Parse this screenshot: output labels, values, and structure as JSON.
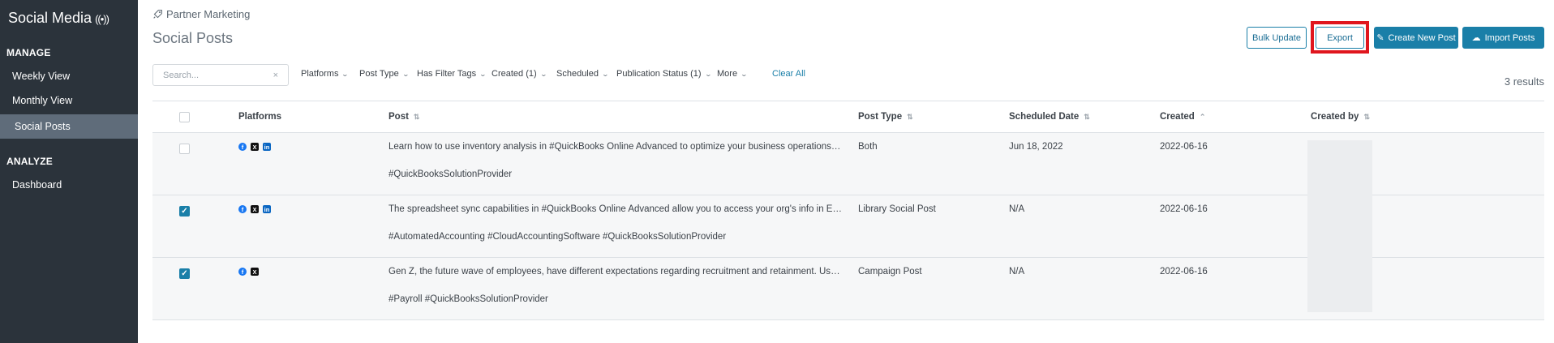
{
  "sidebar": {
    "app_title": "Social Media",
    "manage_label": "MANAGE",
    "analyze_label": "ANALYZE",
    "items": [
      {
        "label": "Weekly View"
      },
      {
        "label": "Monthly View"
      },
      {
        "label": "Social Posts",
        "active": true
      },
      {
        "label": "Dashboard"
      }
    ]
  },
  "header": {
    "breadcrumb": "Partner Marketing",
    "title": "Social Posts"
  },
  "toolbar": {
    "bulk_update": "Bulk Update",
    "export": "Export",
    "create_new_post": "Create New Post",
    "import_posts": "Import Posts"
  },
  "filters": {
    "search_placeholder": "Search...",
    "items": [
      "Platforms",
      "Post Type",
      "Has Filter Tags",
      "Created (1)",
      "Scheduled",
      "Publication Status (1)",
      "More"
    ],
    "clear_all": "Clear All",
    "results": "3 results"
  },
  "table": {
    "columns": [
      "Platforms",
      "Post",
      "Post Type",
      "Scheduled Date",
      "Created",
      "Created by"
    ],
    "rows": [
      {
        "checked": false,
        "platforms": [
          "facebook",
          "x",
          "linkedin"
        ],
        "post": "Learn how to use inventory analysis in #QuickBooks Online Advanced to optimize your business operations: http...",
        "tags": "#QuickBooksSolutionProvider",
        "post_type": "Both",
        "scheduled_date": "Jun 18, 2022",
        "created": "2022-06-16"
      },
      {
        "checked": true,
        "platforms": [
          "facebook",
          "x",
          "linkedin"
        ],
        "post": "The spreadsheet sync capabilities in #QuickBooks Online Advanced allow you to access your org's info in Excel t...",
        "tags": "#AutomatedAccounting #CloudAccountingSoftware #QuickBooksSolutionProvider",
        "post_type": "Library Social Post",
        "scheduled_date": "N/A",
        "created": "2022-06-16"
      },
      {
        "checked": true,
        "platforms": [
          "facebook",
          "x"
        ],
        "post": "Gen Z, the future wave of employees, have different expectations regarding recruitment and retainment. Use the...",
        "tags": "#Payroll #QuickBooksSolutionProvider",
        "post_type": "Campaign Post",
        "scheduled_date": "N/A",
        "created": "2022-06-16"
      }
    ]
  },
  "colors": {
    "sidebar_bg": "#2b333b",
    "accent": "#1a7fa8",
    "highlight_box": "#e0161e"
  }
}
